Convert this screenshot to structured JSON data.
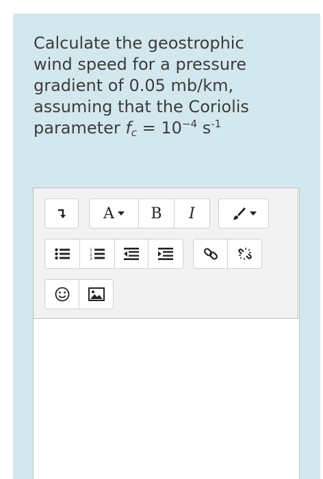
{
  "question": {
    "line1": "Calculate the geostrophic",
    "line2": "wind speed for a pressure",
    "line3": "gradient of 0.05 mb/km,",
    "line4": "assuming that the Coriolis",
    "line5_prefix": "parameter ",
    "symbol": "f",
    "symbol_sub": "c",
    "equals": " = 10",
    "exp1": "−4",
    "unit": " s",
    "exp2": "-1"
  },
  "toolbar": {
    "font_label": "A",
    "bold_label": "B",
    "italic_label": "I"
  },
  "icons": {
    "collapse": "show-more-icon",
    "font": "font-color-icon",
    "bold": "bold-icon",
    "italic": "italic-icon",
    "brush": "paintbrush-icon",
    "ul": "unordered-list-icon",
    "ol": "ordered-list-icon",
    "outdent": "outdent-icon",
    "indent": "indent-icon",
    "link": "link-icon",
    "unlink": "unlink-icon",
    "emoji": "emoji-icon",
    "image": "image-icon"
  }
}
